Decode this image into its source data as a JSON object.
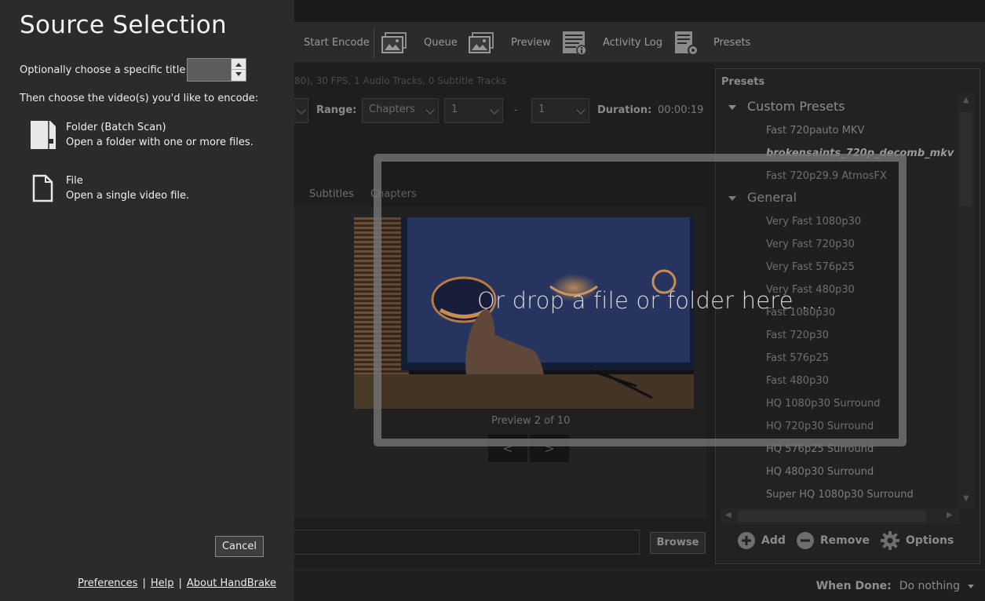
{
  "flyout": {
    "title": "Source Selection",
    "title_choice_label": "Optionally choose a specific title:",
    "title_spinner_value": "",
    "choose_label": "Then choose the video(s) you'd like to encode:",
    "folder_option": {
      "title": "Folder (Batch Scan)",
      "desc": "Open a folder with one or more files.",
      "icon": "folder-icon"
    },
    "file_option": {
      "title": "File",
      "desc": "Open a single video file.",
      "icon": "file-icon"
    },
    "cancel_label": "Cancel",
    "links": [
      "Preferences",
      "Help",
      "About HandBrake"
    ]
  },
  "toolbar": {
    "start_encode": "Start Encode",
    "queue": "Queue",
    "preview": "Preview",
    "activity_log": "Activity Log",
    "presets": "Presets"
  },
  "source_info": "80), 30 FPS, 1 Audio Tracks, 0 Subtitle Tracks",
  "range": {
    "label": "Range:",
    "mode": "Chapters",
    "start": "1",
    "dash": "-",
    "end": "1",
    "duration_label": "Duration:",
    "duration_value": "00:00:19"
  },
  "tabs": [
    "Subtitles",
    "Chapters"
  ],
  "preview": {
    "label": "Preview 2 of 10",
    "prev": "<",
    "next": ">"
  },
  "destination": {
    "browse_label": "Browse"
  },
  "drop_text": "Or drop a file or folder here ...",
  "presets_panel": {
    "title": "Presets",
    "groups": [
      {
        "name": "Custom Presets",
        "items": [
          "Fast 720pauto MKV",
          "brokensaints_720p_decomb_mkv",
          "Fast 720p29.9 AtmosFX"
        ]
      },
      {
        "name": "General",
        "items": [
          "Very Fast 1080p30",
          "Very Fast 720p30",
          "Very Fast 576p25",
          "Very Fast 480p30",
          "Fast 1080p30",
          "Fast 720p30",
          "Fast 576p25",
          "Fast 480p30",
          "HQ 1080p30 Surround",
          "HQ 720p30 Surround",
          "HQ 576p25 Surround",
          "HQ 480p30 Surround",
          "Super HQ 1080p30 Surround"
        ]
      }
    ],
    "selected": "brokensaints_720p_decomb_mkv",
    "add_label": "Add",
    "remove_label": "Remove",
    "options_label": "Options"
  },
  "when_done": {
    "label": "When Done:",
    "value": "Do nothing"
  }
}
